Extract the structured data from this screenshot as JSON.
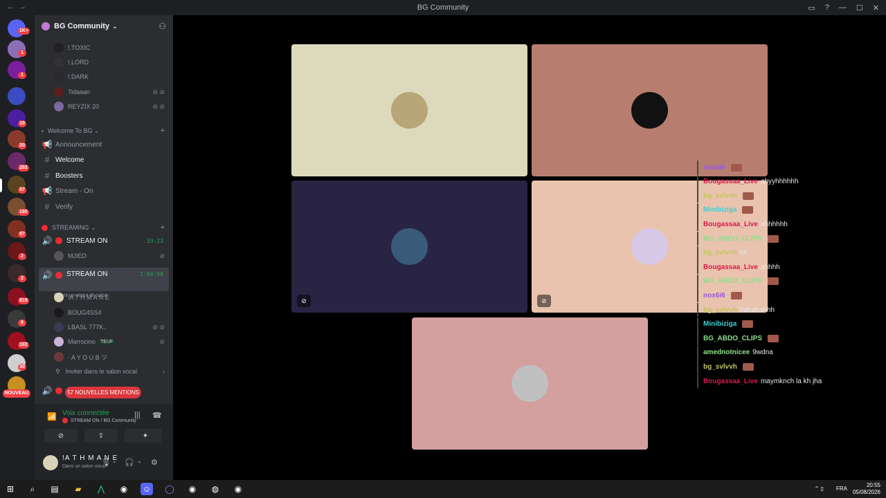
{
  "titlebar": {
    "title": "BG Community"
  },
  "guild_badges": [
    "1K+",
    "1",
    "1",
    "10",
    "20",
    "283",
    "57",
    "180",
    "57",
    "2",
    "2",
    "819",
    "8",
    "182",
    "30"
  ],
  "guild_new": "NOUVEAU",
  "server": {
    "name": "BG Community"
  },
  "top_members": [
    {
      "name": "!.TOXIC"
    },
    {
      "name": "!.LORD"
    },
    {
      "name": "!.DARK"
    },
    {
      "name": "7idaaan"
    },
    {
      "name": "REYZIX 20"
    }
  ],
  "categories": {
    "welcome": "Welcome To BG",
    "streaming": "STREAMING"
  },
  "channels": [
    {
      "label": "Announcement"
    },
    {
      "label": "Welcome"
    },
    {
      "label": "Boosters"
    },
    {
      "label": "Stream - On"
    },
    {
      "label": "Verify"
    }
  ],
  "stream1": {
    "label": "STREAM ON",
    "timer": "33:23",
    "member": "MJIED"
  },
  "stream2": {
    "label": "STREAM ON",
    "timer": "1:54:59",
    "status": "Définir un statut de salon",
    "members": [
      {
        "name": "!A T H M A N E"
      },
      {
        "name": "BOUG4SS4"
      },
      {
        "name": "LBASL 777K.."
      },
      {
        "name": "Marrocino",
        "tag": "TEUF"
      },
      {
        "name": "· A Y O U B ツ"
      }
    ],
    "invite": "Inviter dans le salon vocal"
  },
  "mentions": "57 NOUVELLES MENTIONS",
  "voice": {
    "title": "Voix connectée",
    "sub": "STREAM ON / BG Community"
  },
  "user": {
    "name": "!A T H M A N E",
    "status": "Dans un salon vocal"
  },
  "chat": [
    {
      "nick": "nox6i6",
      "msg": "",
      "color": "#9b59d6",
      "emote": true
    },
    {
      "nick": "Bougassaa_Live",
      "msg": "ahyyhhhhhh",
      "color": "#e0174a",
      "emote": false
    },
    {
      "nick": "bg_svlvvh",
      "msg": "",
      "color": "#c8c264",
      "emote": true
    },
    {
      "nick": "Minibiziga",
      "msg": "",
      "color": "#3fd1d1",
      "emote": true
    },
    {
      "nick": "Bougassaa_Live",
      "msg": "ahhhhhh",
      "color": "#e0174a",
      "emote": false
    },
    {
      "nick": "BG_ABDO_CLIPS",
      "msg": "",
      "color": "#8be08b",
      "emote": true
    },
    {
      "nick": "bg_svlvvh",
      "msg": "lol",
      "color": "#c8c264",
      "emote": false
    },
    {
      "nick": "Bougassaa_Live",
      "msg": "ahhhh",
      "color": "#e0174a",
      "emote": false
    },
    {
      "nick": "BG_ABDO_CLIPS",
      "msg": "",
      "color": "#8be08b",
      "emote": true
    },
    {
      "nick": "nox6i6",
      "msg": "",
      "color": "#9b59d6",
      "emote": true
    },
    {
      "nick": "bg_svlvvh",
      "msg": "hahahahhh",
      "color": "#c8c264",
      "emote": false
    },
    {
      "nick": "Minibiziga",
      "msg": "",
      "color": "#3fd1d1",
      "emote": true
    },
    {
      "nick": "BG_ABDO_CLIPS",
      "msg": "",
      "color": "#8be08b",
      "emote": true
    },
    {
      "nick": "amednotnicee",
      "msg": "9wdna",
      "color": "#8be08b",
      "emote": false
    },
    {
      "nick": "bg_svlvvh",
      "msg": "",
      "color": "#c8c264",
      "emote": true
    },
    {
      "nick": "Bougassaa_Live",
      "msg": "maymknch la kh jha",
      "color": "#e0174a",
      "emote": false
    }
  ],
  "tiles": [
    {
      "bg": "#ddd9bc"
    },
    {
      "bg": "#b77e70"
    },
    {
      "bg": "#2a2444"
    },
    {
      "bg": "#e9c3ae"
    },
    {
      "bg": "#d3a09f"
    }
  ],
  "taskbar": {
    "lang": "FRA",
    "time": "20:55",
    "date": "05/08/2026"
  },
  "colors": {
    "accent_green": "#23a55a",
    "mention_red": "#da373c"
  }
}
